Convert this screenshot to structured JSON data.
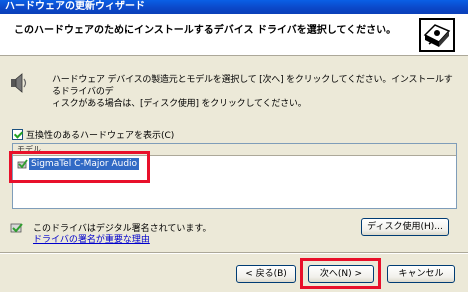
{
  "window": {
    "title": "ハードウェアの更新ウィザード"
  },
  "header": {
    "title": "このハードウェアのためにインストールするデバイス ドライバを選択してください。",
    "icon": "hardware-wizard-icon"
  },
  "description": {
    "icon": "speaker-icon",
    "line1": "ハードウェア デバイスの製造元とモデルを選択して [次へ] をクリックしてください。インストールするドライバのデ",
    "line2": "ィスクがある場合は、[ディスク使用] をクリックしてください。"
  },
  "compatible": {
    "checked": true,
    "label": "互換性のあるハードウェアを表示(C)"
  },
  "model_list": {
    "header": "モデル",
    "items": [
      {
        "label": "SigmaTel C-Major Audio",
        "selected": true,
        "icon": "device-icon"
      }
    ]
  },
  "signature": {
    "icon": "signed-driver-icon",
    "text": "このドライバはデジタル署名されています。",
    "link": "ドライバの署名が重要な理由"
  },
  "buttons": {
    "disk": "ディスク使用(H)...",
    "back": "< 戻る(B)",
    "next": "次へ(N) >",
    "cancel": "キャンセル"
  },
  "colors": {
    "highlight": "#E8102A",
    "selection": "#316AC5",
    "titlebar": "#0A5FE6",
    "face": "#ECE9D8"
  }
}
